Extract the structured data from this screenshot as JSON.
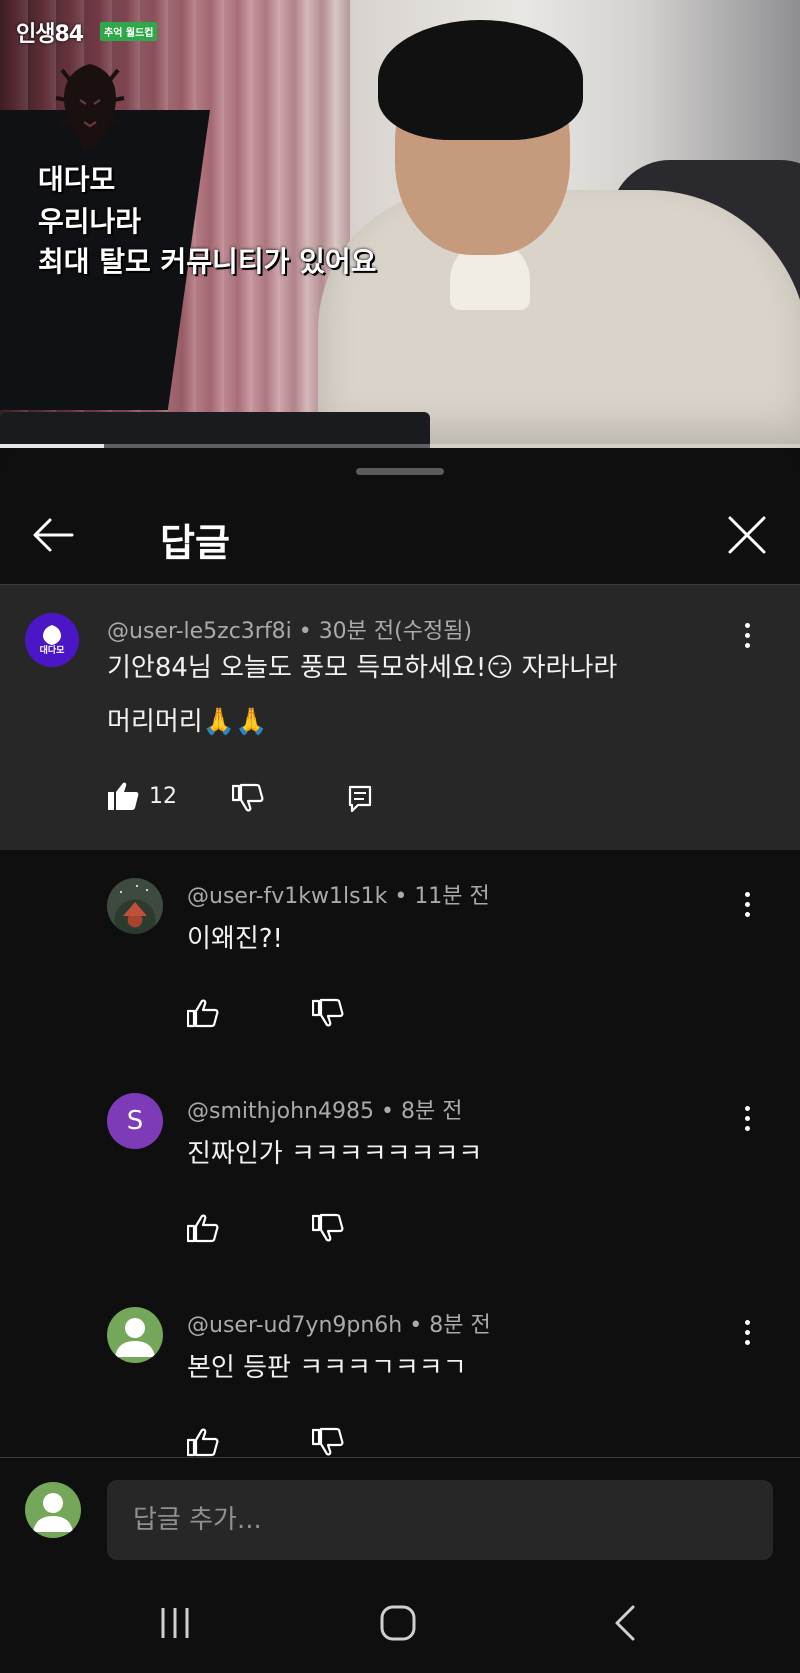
{
  "video": {
    "channel_logo": "인생84",
    "logo_badge": "추억 월드컵",
    "caption_line1": "대다모",
    "caption_line2": "우리나라",
    "caption_line3": "최대 탈모 커뮤니티가 있어요",
    "progress": 0.13
  },
  "header": {
    "title": "답글"
  },
  "parent_comment": {
    "avatar_text": "대다모",
    "author": "@user-le5zc3rf8i",
    "time": "30분 전(수정됨)",
    "text_line1": "기안84님 오늘도 풍모 득모하세요!😏 자라나라",
    "text_line2": "머리머리🙏🙏",
    "like_count": "12"
  },
  "replies": [
    {
      "author": "@user-fv1kw1ls1k",
      "time": "11분 전",
      "text": "이왜진?!",
      "avatar": "tent-icon"
    },
    {
      "author": "@smithjohn4985",
      "time": "8분 전",
      "text": "진짜인가 ㅋㅋㅋㅋㅋㅋㅋㅋ",
      "avatar_letter": "S"
    },
    {
      "author": "@user-ud7yn9pn6h",
      "time": "8분 전",
      "text": "본인 등판 ㅋㅋㅋㄱㅋㅋㄱ",
      "avatar": "default-person-icon"
    }
  ],
  "compose": {
    "placeholder": "답글 추가..."
  },
  "colors": {
    "background": "#0f0f0f",
    "highlight": "#272727",
    "meta_text": "#aaaaaa"
  }
}
